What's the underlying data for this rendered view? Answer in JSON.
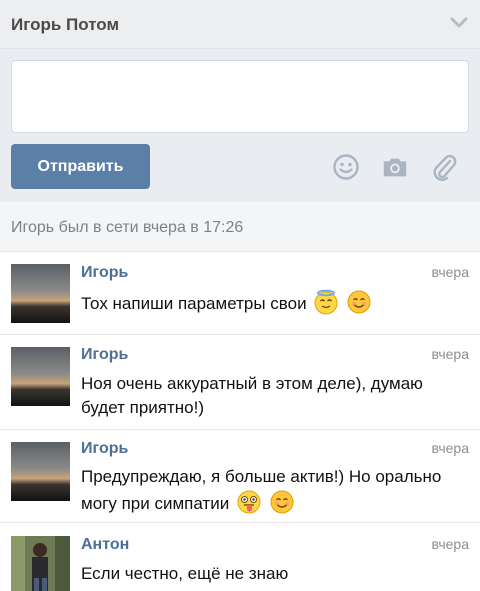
{
  "header": {
    "title": "Игорь Потом",
    "chevron_icon": "chevron-down-icon"
  },
  "composer": {
    "input_value": "",
    "input_placeholder": "",
    "send_label": "Отправить",
    "tools": [
      "smiley-icon",
      "camera-icon",
      "paperclip-icon"
    ]
  },
  "status": {
    "text": "Игорь был в сети вчера в 17:26"
  },
  "messages": [
    {
      "sender": "Игорь",
      "time": "вчера",
      "text": "Тох напиши параметры свои",
      "emoji": [
        "angel-emoji",
        "smile-emoji"
      ]
    },
    {
      "sender": "Игорь",
      "time": "вчера",
      "text": "Ноя очень аккуратный в этом деле), думаю будет приятно!)",
      "emoji": []
    },
    {
      "sender": "Игорь",
      "time": "вчера",
      "text": "Предупреждаю, я больше актив!) Но орально могу при симпатии",
      "emoji": [
        "wink-tongue-emoji",
        "smile-emoji"
      ]
    },
    {
      "sender": "Антон",
      "time": "вчера",
      "text": "Если честно, ещё не знаю",
      "emoji": []
    }
  ],
  "colors": {
    "accent": "#5b7fa6",
    "link": "#4e6f98",
    "header_bg": "#edeef0"
  }
}
